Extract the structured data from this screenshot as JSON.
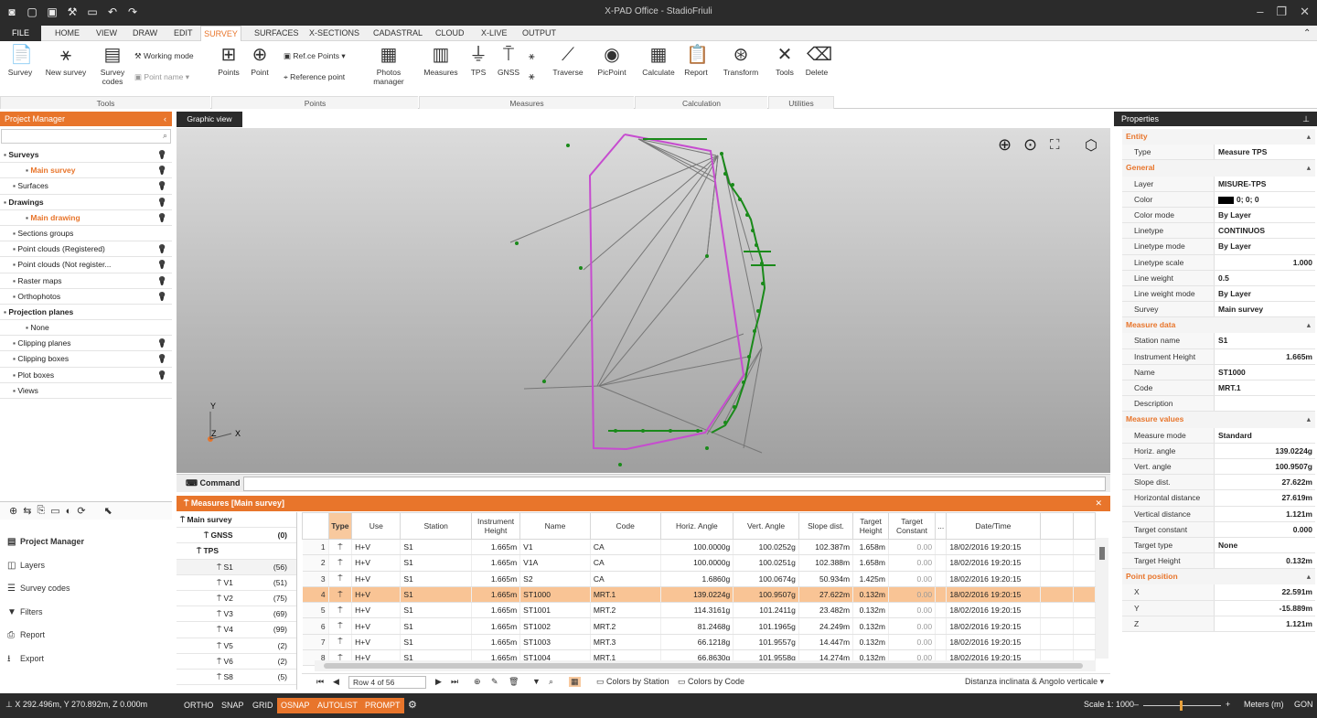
{
  "app": {
    "title": "X-PAD Office - StadioFriuli"
  },
  "menu": {
    "file": "FILE",
    "tabs": [
      "HOME",
      "VIEW",
      "DRAW",
      "EDIT",
      "SURVEY",
      "SURFACES",
      "X-SECTIONS",
      "CADASTRAL",
      "CLOUD",
      "X-LIVE",
      "OUTPUT"
    ],
    "active": "SURVEY"
  },
  "ribbon": {
    "survey": "Survey",
    "new_survey": "New survey",
    "survey_codes": "Survey codes",
    "working_mode": "Working mode",
    "point_name": "Point name",
    "points": "Points",
    "point": "Point",
    "refce_points": "Ref.ce Points",
    "reference_point": "Reference point",
    "photos_manager": "Photos manager",
    "measures": "Measures",
    "tps": "TPS",
    "gnss": "GNSS",
    "traverse": "Traverse",
    "picpoint": "PicPoint",
    "calculate": "Calculate",
    "report": "Report",
    "transform": "Transform",
    "tools": "Tools",
    "delete": "Delete",
    "groups": {
      "tools": "Tools",
      "points": "Points",
      "measures": "Measures",
      "calculation": "Calculation",
      "utilities": "Utilities"
    }
  },
  "project_manager": {
    "title": "Project Manager",
    "tree": [
      {
        "label": "Surveys",
        "style": "bold",
        "indent": 4,
        "bulb": true
      },
      {
        "label": "Main survey",
        "style": "orange",
        "indent": 28,
        "bulb": true
      },
      {
        "label": "Surfaces",
        "style": "",
        "indent": 14,
        "bulb": true
      },
      {
        "label": "Drawings",
        "style": "bold",
        "indent": 4,
        "bulb": true
      },
      {
        "label": "Main drawing",
        "style": "orange",
        "indent": 28,
        "bulb": true
      },
      {
        "label": "Sections groups",
        "style": "",
        "indent": 14,
        "bulb": false
      },
      {
        "label": "Point clouds (Registered)",
        "style": "",
        "indent": 14,
        "bulb": true
      },
      {
        "label": "Point clouds (Not register...",
        "style": "",
        "indent": 14,
        "bulb": true
      },
      {
        "label": "Raster maps",
        "style": "",
        "indent": 14,
        "bulb": true
      },
      {
        "label": "Orthophotos",
        "style": "",
        "indent": 14,
        "bulb": true
      },
      {
        "label": "Projection planes",
        "style": "bold",
        "indent": 4,
        "bulb": false
      },
      {
        "label": "None",
        "style": "sel",
        "indent": 28,
        "bulb": false
      },
      {
        "label": "Clipping planes",
        "style": "",
        "indent": 14,
        "bulb": true
      },
      {
        "label": "Clipping boxes",
        "style": "",
        "indent": 14,
        "bulb": true
      },
      {
        "label": "Plot boxes",
        "style": "",
        "indent": 14,
        "bulb": true
      },
      {
        "label": "Views",
        "style": "",
        "indent": 14,
        "bulb": false
      }
    ],
    "nav": [
      {
        "label": "Project Manager",
        "icon": "▤",
        "bold": true
      },
      {
        "label": "Layers",
        "icon": "◫",
        "bold": false
      },
      {
        "label": "Survey codes",
        "icon": "☰",
        "bold": false
      },
      {
        "label": "Filters",
        "icon": "▼",
        "bold": false
      },
      {
        "label": "Report",
        "icon": "⎙",
        "bold": false
      },
      {
        "label": "Export",
        "icon": "⭳",
        "bold": false
      }
    ]
  },
  "graphic": {
    "tab": "Graphic view",
    "axes": {
      "y": "Y",
      "z": "Z",
      "x": "X"
    }
  },
  "command": {
    "label": "Command"
  },
  "measures": {
    "title": "Measures [Main survey]",
    "tree": [
      {
        "label": "Main survey",
        "count": "",
        "indent": 4,
        "bold": true
      },
      {
        "label": "GNSS",
        "count": "(0)",
        "indent": 30,
        "bold": true
      },
      {
        "label": "TPS",
        "count": "",
        "indent": 22,
        "bold": true
      },
      {
        "label": "S1",
        "count": "(56)",
        "indent": 44,
        "bold": false,
        "sel": true
      },
      {
        "label": "V1",
        "count": "(51)",
        "indent": 44,
        "bold": false
      },
      {
        "label": "V2",
        "count": "(75)",
        "indent": 44,
        "bold": false
      },
      {
        "label": "V3",
        "count": "(69)",
        "indent": 44,
        "bold": false
      },
      {
        "label": "V4",
        "count": "(99)",
        "indent": 44,
        "bold": false
      },
      {
        "label": "V5",
        "count": "(2)",
        "indent": 44,
        "bold": false
      },
      {
        "label": "V6",
        "count": "(2)",
        "indent": 44,
        "bold": false
      },
      {
        "label": "S8",
        "count": "(5)",
        "indent": 44,
        "bold": false
      }
    ],
    "columns": [
      "Type",
      "Use",
      "Station",
      "Instrument Height",
      "Name",
      "Code",
      "Horiz. Angle",
      "Vert. Angle",
      "Slope dist.",
      "Target Height",
      "Target Constant",
      "...",
      "Date/Time",
      "",
      ""
    ],
    "rows": [
      [
        "1",
        "H+V",
        "S1",
        "1.665m",
        "V1",
        "CA",
        "100.0000g",
        "100.0252g",
        "102.387m",
        "1.658m",
        "0.00",
        "18/02/2016 19:20:15"
      ],
      [
        "2",
        "H+V",
        "S1",
        "1.665m",
        "V1A",
        "CA",
        "100.0000g",
        "100.0251g",
        "102.388m",
        "1.658m",
        "0.00",
        "18/02/2016 19:20:15"
      ],
      [
        "3",
        "H+V",
        "S1",
        "1.665m",
        "S2",
        "CA",
        "1.6860g",
        "100.0674g",
        "50.934m",
        "1.425m",
        "0.00",
        "18/02/2016 19:20:15"
      ],
      [
        "4",
        "H+V",
        "S1",
        "1.665m",
        "ST1000",
        "MRT.1",
        "139.0224g",
        "100.9507g",
        "27.622m",
        "0.132m",
        "0.00",
        "18/02/2016 19:20:15"
      ],
      [
        "5",
        "H+V",
        "S1",
        "1.665m",
        "ST1001",
        "MRT.2",
        "114.3161g",
        "101.2411g",
        "23.482m",
        "0.132m",
        "0.00",
        "18/02/2016 19:20:15"
      ],
      [
        "6",
        "H+V",
        "S1",
        "1.665m",
        "ST1002",
        "MRT.2",
        "81.2468g",
        "101.1965g",
        "24.249m",
        "0.132m",
        "0.00",
        "18/02/2016 19:20:15"
      ],
      [
        "7",
        "H+V",
        "S1",
        "1.665m",
        "ST1003",
        "MRT.3",
        "66.1218g",
        "101.9557g",
        "14.447m",
        "0.132m",
        "0.00",
        "18/02/2016 19:20:15"
      ],
      [
        "8",
        "H+V",
        "S1",
        "1.665m",
        "ST1004",
        "MRT.1",
        "66.8630g",
        "101.9558g",
        "14.274m",
        "0.132m",
        "0.00",
        "18/02/2016 19:20:15"
      ]
    ],
    "selected_row": 4,
    "footer": {
      "row": "Row 4 of 56",
      "colors_station": "Colors by Station",
      "colors_code": "Colors by Code",
      "mode": "Distanza inclinata & Angolo verticale"
    }
  },
  "properties": {
    "title": "Properties",
    "sections": [
      {
        "title": "Entity",
        "rows": [
          [
            "Type",
            "Measure TPS",
            ""
          ]
        ]
      },
      {
        "title": "General",
        "rows": [
          [
            "Layer",
            "MISURE-TPS",
            ""
          ],
          [
            "Color",
            "0; 0; 0",
            "swatch"
          ],
          [
            "Color mode",
            "By Layer",
            ""
          ],
          [
            "Linetype",
            "CONTINUOS",
            ""
          ],
          [
            "Linetype mode",
            "By Layer",
            ""
          ],
          [
            "Linetype scale",
            "1.000",
            "r"
          ],
          [
            "Line weight",
            "0.5",
            ""
          ],
          [
            "Line weight mode",
            "By Layer",
            ""
          ],
          [
            "Survey",
            "Main survey",
            ""
          ]
        ]
      },
      {
        "title": "Measure data",
        "rows": [
          [
            "Station name",
            "S1",
            ""
          ],
          [
            "Instrument Height",
            "1.665m",
            "r"
          ],
          [
            "Name",
            "ST1000",
            ""
          ],
          [
            "Code",
            "MRT.1",
            ""
          ],
          [
            "Description",
            "",
            ""
          ]
        ]
      },
      {
        "title": "Measure values",
        "rows": [
          [
            "Measure mode",
            "Standard",
            ""
          ],
          [
            "Horiz. angle",
            "139.0224g",
            "r"
          ],
          [
            "Vert. angle",
            "100.9507g",
            "r"
          ],
          [
            "Slope dist.",
            "27.622m",
            "r"
          ],
          [
            "Horizontal distance",
            "27.619m",
            "r"
          ],
          [
            "Vertical distance",
            "1.121m",
            "r"
          ],
          [
            "Target constant",
            "0.000",
            "r"
          ],
          [
            "Target type",
            "None",
            ""
          ],
          [
            "Target Height",
            "0.132m",
            "r"
          ]
        ]
      },
      {
        "title": "Point position",
        "rows": [
          [
            "X",
            "22.591m",
            "r"
          ],
          [
            "Y",
            "-15.889m",
            "r"
          ],
          [
            "Z",
            "1.121m",
            "r"
          ]
        ]
      }
    ]
  },
  "status": {
    "coords": "X 292.496m, Y 270.892m, Z 0.000m",
    "ortho": "ORTHO",
    "snap": "SNAP",
    "grid": "GRID",
    "osnap": "OSNAP",
    "autolist": "AUTOLIST",
    "prompt": "PROMPT",
    "scale": "Scale 1: 1000",
    "units": "Meters (m)",
    "gon": "GON"
  }
}
